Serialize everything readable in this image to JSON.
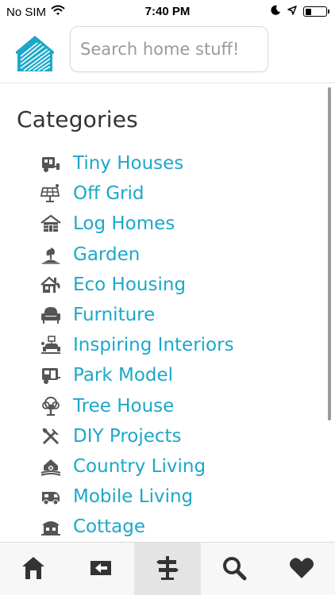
{
  "status_bar": {
    "carrier": "No SIM",
    "time": "7:40 PM",
    "battery_level": 0.3
  },
  "header": {
    "logo_icon": "house-logo-icon",
    "search": {
      "placeholder": "Search home stuff!",
      "value": ""
    }
  },
  "colors": {
    "accent": "#1ca8c9",
    "title": "#333333",
    "icon": "#555555"
  },
  "categories": {
    "title": "Categories",
    "items": [
      {
        "label": "Tiny Houses",
        "icon": "tiny-house-trailer-icon"
      },
      {
        "label": "Off Grid",
        "icon": "solar-panel-icon"
      },
      {
        "label": "Log Homes",
        "icon": "log-cabin-icon"
      },
      {
        "label": "Garden",
        "icon": "plant-icon"
      },
      {
        "label": "Eco Housing",
        "icon": "eco-house-icon"
      },
      {
        "label": "Furniture",
        "icon": "armchair-icon"
      },
      {
        "label": "Inspiring Interiors",
        "icon": "interior-icon"
      },
      {
        "label": "Park Model",
        "icon": "park-model-icon"
      },
      {
        "label": "Tree House",
        "icon": "tree-house-icon"
      },
      {
        "label": "DIY Projects",
        "icon": "tools-icon"
      },
      {
        "label": "Country Living",
        "icon": "barn-icon"
      },
      {
        "label": "Mobile Living",
        "icon": "camper-van-icon"
      },
      {
        "label": "Cottage",
        "icon": "cottage-icon"
      }
    ]
  },
  "tab_bar": {
    "tabs": [
      {
        "icon": "home-icon",
        "active": false
      },
      {
        "icon": "back-icon",
        "active": false
      },
      {
        "icon": "signpost-icon",
        "active": true
      },
      {
        "icon": "search-icon",
        "active": false
      },
      {
        "icon": "heart-icon",
        "active": false
      }
    ]
  }
}
